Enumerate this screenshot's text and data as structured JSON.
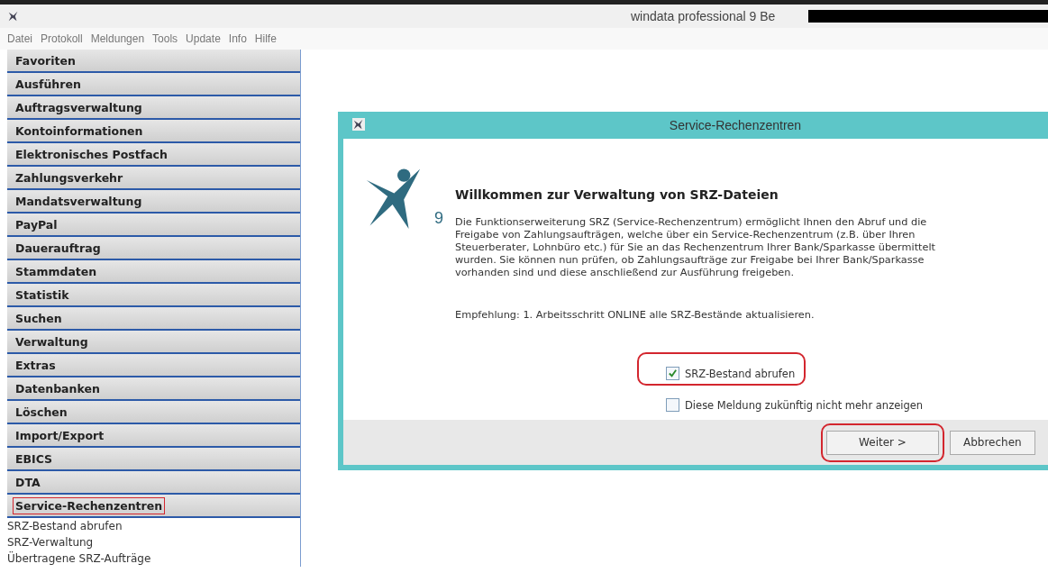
{
  "window": {
    "title": "windata professional 9 Be",
    "title_redacted": true
  },
  "menu": [
    "Datei",
    "Protokoll",
    "Meldungen",
    "Tools",
    "Update",
    "Info",
    "Hilfe"
  ],
  "sidebar": {
    "sections": [
      {
        "label": "Favoriten",
        "highlighted": false
      },
      {
        "label": "Ausführen",
        "highlighted": false
      },
      {
        "label": "Auftragsverwaltung",
        "highlighted": false
      },
      {
        "label": "Kontoinformationen",
        "highlighted": false
      },
      {
        "label": "Elektronisches Postfach",
        "highlighted": false
      },
      {
        "label": "Zahlungsverkehr",
        "highlighted": false
      },
      {
        "label": "Mandatsverwaltung",
        "highlighted": false
      },
      {
        "label": "PayPal",
        "highlighted": false
      },
      {
        "label": "Dauerauftrag",
        "highlighted": false
      },
      {
        "label": "Stammdaten",
        "highlighted": false
      },
      {
        "label": "Statistik",
        "highlighted": false
      },
      {
        "label": "Suchen",
        "highlighted": false
      },
      {
        "label": "Verwaltung",
        "highlighted": false
      },
      {
        "label": "Extras",
        "highlighted": false
      },
      {
        "label": "Datenbanken",
        "highlighted": false
      },
      {
        "label": "Löschen",
        "highlighted": false
      },
      {
        "label": "Import/Export",
        "highlighted": false
      },
      {
        "label": "EBICS",
        "highlighted": false
      },
      {
        "label": "DTA",
        "highlighted": false
      },
      {
        "label": "Service-Rechenzentren",
        "highlighted": true,
        "children": [
          {
            "label": "SRZ-Bestand abrufen"
          },
          {
            "label": "SRZ-Verwaltung"
          },
          {
            "label": "Übertragene SRZ-Aufträge"
          }
        ]
      }
    ]
  },
  "dialog": {
    "title": "Service-Rechenzentren",
    "logo_badge": "9",
    "heading": "Willkommen zur Verwaltung von SRZ-Dateien",
    "paragraph": "Die Funktionserweiterung SRZ (Service-Rechenzentrum) ermöglicht Ihnen den Abruf und die\nFreigabe von Zahlungsaufträgen, welche über ein Service-Rechenzentrum (z.B. über Ihren\nSteuerberater, Lohnbüro etc.) für Sie an das Rechenzentrum Ihrer Bank/Sparkasse übermittelt\nwurden. Sie können nun prüfen, ob Zahlungsaufträge zur Freigabe bei Ihrer Bank/Sparkasse\nvorhanden sind und diese anschließend zur Ausführung freigeben.",
    "recommendation": "Empfehlung: 1. Arbeitsschritt ONLINE alle SRZ-Bestände aktualisieren.",
    "checkboxes": [
      {
        "label": "SRZ-Bestand abrufen",
        "checked": true,
        "highlighted": true
      },
      {
        "label": "Diese Meldung zukünftig nicht mehr anzeigen",
        "checked": false,
        "highlighted": false
      }
    ],
    "buttons": [
      {
        "label": "Weiter >",
        "highlighted": true
      },
      {
        "label": "Abbrechen",
        "highlighted": false
      }
    ]
  }
}
